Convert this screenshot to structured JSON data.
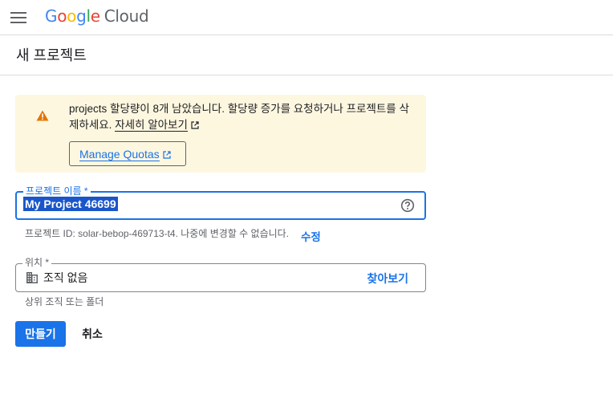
{
  "header": {
    "menu_icon": "hamburger-menu-icon",
    "logo": {
      "letters": [
        "G",
        "o",
        "o",
        "g",
        "l",
        "e"
      ],
      "product": "Cloud"
    }
  },
  "page": {
    "title": "새 프로젝트"
  },
  "quota_warning": {
    "icon": "warning-icon",
    "message": "projects 할당량이 8개 남았습니다. 할당량 증가를 요청하거나 프로젝트를 삭제하세요.",
    "learn_more_label": "자세히 알아보기",
    "manage_quotas_label": "Manage Quotas",
    "accent_color": "#e37400",
    "background_color": "#fef7e0"
  },
  "project_name": {
    "label": "프로젝트 이름 *",
    "value": "My Project 46699",
    "help_icon": "help-circle-icon",
    "hint_prefix": "프로젝트 ID: solar-bebop-469713-t4. 나중에 변경할 수 없습니다.",
    "edit_label": "수정"
  },
  "location": {
    "label": "위치 *",
    "icon": "building-icon",
    "value": "조직 없음",
    "browse_label": "찾아보기",
    "hint": "상위 조직 또는 폴더"
  },
  "actions": {
    "create_label": "만들기",
    "cancel_label": "취소",
    "primary_color": "#1a73e8"
  }
}
